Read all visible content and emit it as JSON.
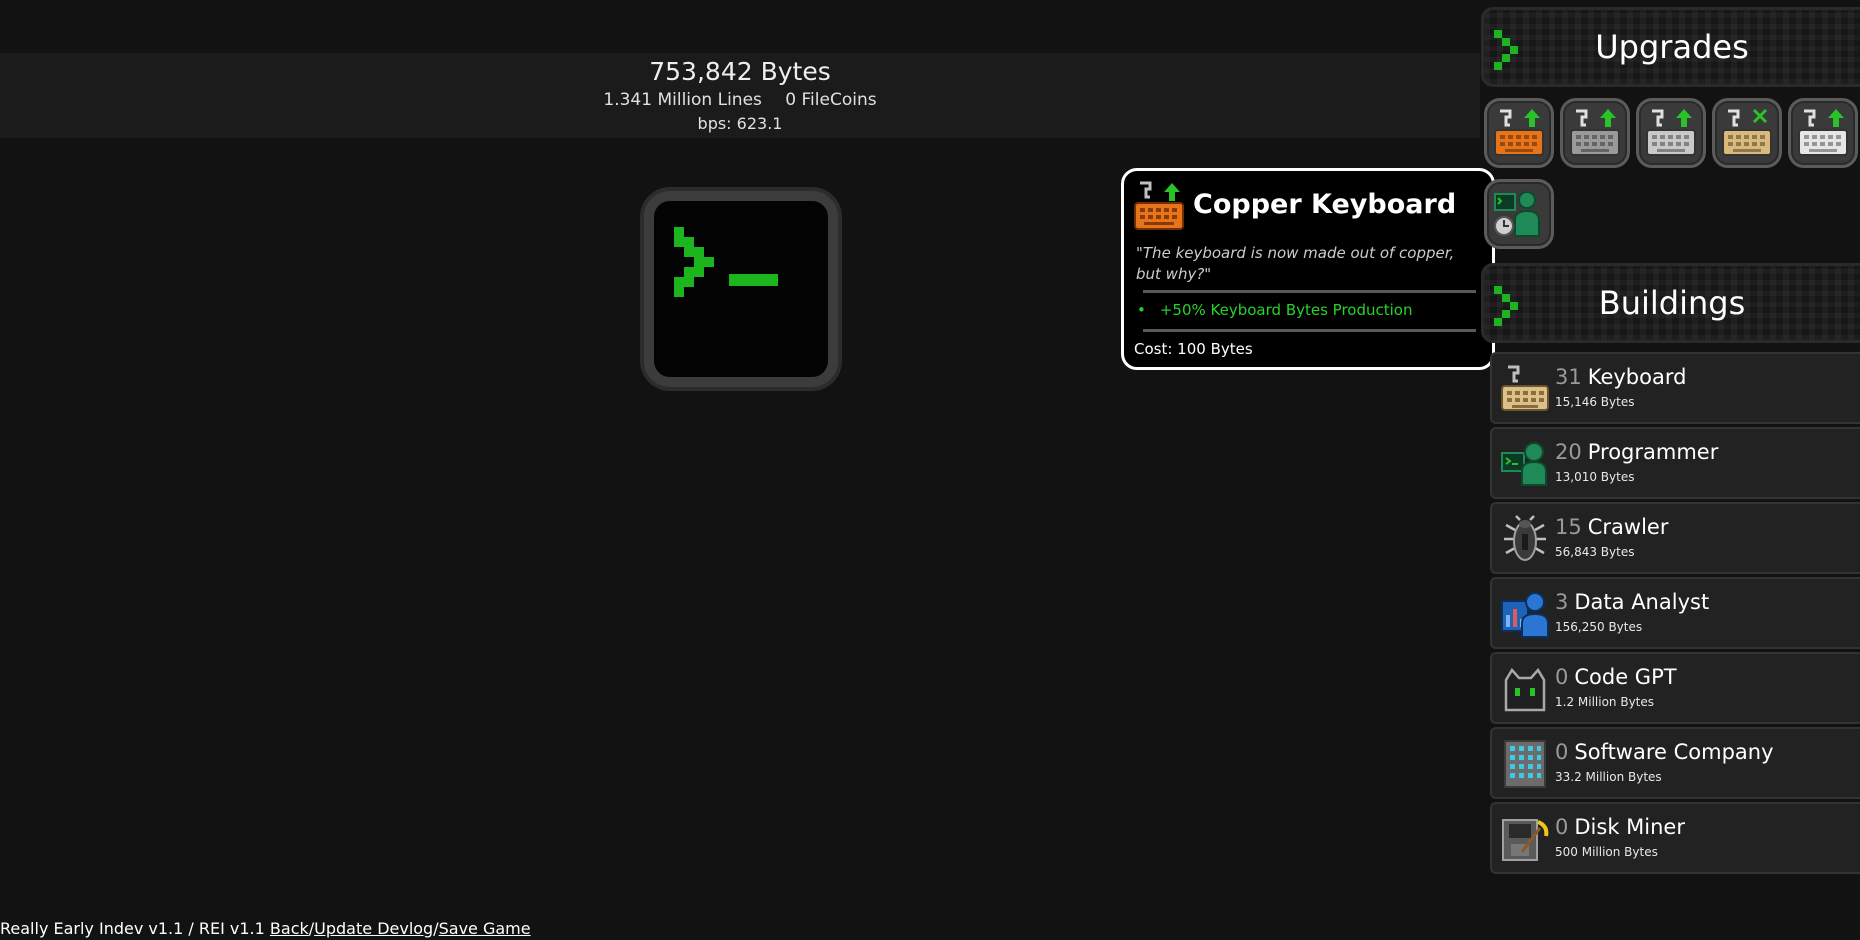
{
  "stats": {
    "bytes": "753,842 Bytes",
    "lines": "1.341 Million Lines",
    "filecoins": "0 FileCoins",
    "bps": "bps: 623.1"
  },
  "clicker": {
    "icon": "terminal-prompt-icon"
  },
  "tooltip": {
    "title": "Copper Keyboard",
    "quote": "\"The keyboard is now made out of copper, but why?\"",
    "effect": "+50% Keyboard Bytes Production",
    "cost": "Cost: 100 Bytes",
    "icon": "copper-keyboard-upgrade-icon"
  },
  "upgrades": {
    "title": "Upgrades",
    "items": [
      {
        "icon": "copper-keyboard-upgrade-icon",
        "color": "#e8741a",
        "badge": "arrow"
      },
      {
        "icon": "silver-keyboard-upgrade-icon",
        "color": "#9a9a9a",
        "badge": "arrow"
      },
      {
        "icon": "white-keyboard-upgrade-icon",
        "color": "#c9c9c9",
        "badge": "arrow"
      },
      {
        "icon": "tan-keyboard-upgrade-icon",
        "color": "#d9b97c",
        "badge": "x"
      },
      {
        "icon": "bright-keyboard-upgrade-icon",
        "color": "#e6e6e6",
        "badge": "arrow"
      },
      {
        "icon": "programmer-clock-upgrade-icon",
        "color": "#1f8a57",
        "badge": "clock"
      }
    ]
  },
  "buildings": {
    "title": "Buildings",
    "items": [
      {
        "count": "31",
        "name": "Keyboard",
        "cost": "15,146 Bytes",
        "icon": "keyboard-icon"
      },
      {
        "count": "20",
        "name": "Programmer",
        "cost": "13,010 Bytes",
        "icon": "programmer-icon"
      },
      {
        "count": "15",
        "name": "Crawler",
        "cost": "56,843 Bytes",
        "icon": "crawler-bug-icon"
      },
      {
        "count": "3",
        "name": "Data Analyst",
        "cost": "156,250 Bytes",
        "icon": "data-analyst-icon"
      },
      {
        "count": "0",
        "name": "Code GPT",
        "cost": "1.2 Million Bytes",
        "icon": "robot-cat-icon"
      },
      {
        "count": "0",
        "name": "Software Company",
        "cost": "33.2 Million Bytes",
        "icon": "office-building-icon"
      },
      {
        "count": "0",
        "name": "Disk Miner",
        "cost": "500 Million Bytes",
        "icon": "disk-pickaxe-icon"
      }
    ]
  },
  "footer": {
    "version": "Really Early Indev v1.1 / REI v1.1",
    "back": "Back",
    "update": "Update Devlog",
    "save": "Save Game",
    "sep": "/"
  },
  "colors": {
    "accent_green": "#1db51d",
    "effect_green": "#27d227",
    "background": "#121212"
  }
}
